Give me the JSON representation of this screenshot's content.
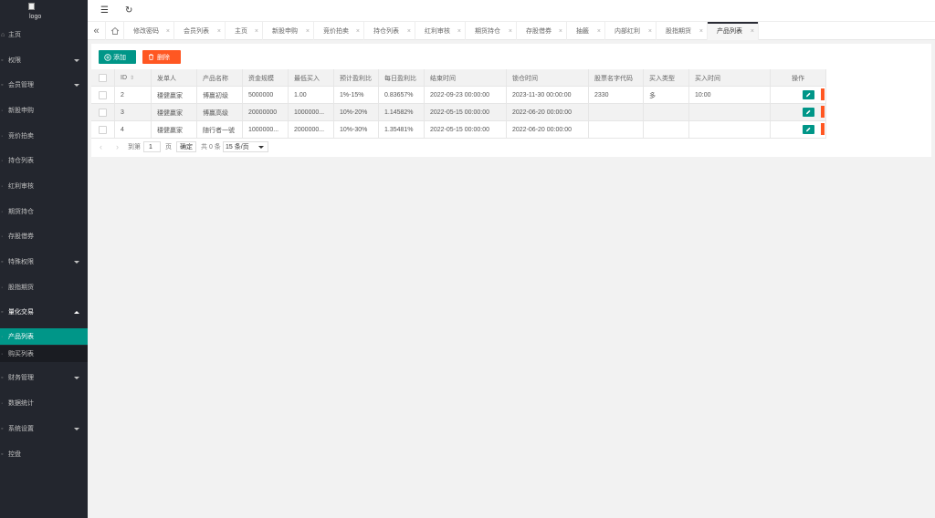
{
  "sidebar": {
    "logo_alt": "logo",
    "items": [
      {
        "label": "主页",
        "icon": "home-icon"
      },
      {
        "label": "权限",
        "icon": "lock-icon",
        "expandable": true
      },
      {
        "label": "会员管理",
        "icon": "user-icon",
        "expandable": true
      },
      {
        "label": "新股申购",
        "icon": "list-icon"
      },
      {
        "label": "竞价拍卖",
        "icon": "list-icon"
      },
      {
        "label": "持仓列表",
        "icon": "list-icon"
      },
      {
        "label": "红利审核",
        "icon": "list-icon"
      },
      {
        "label": "期货持仓",
        "icon": "list-icon"
      },
      {
        "label": "存股借券",
        "icon": "list-icon"
      },
      {
        "label": "特殊权限",
        "icon": "gear-icon",
        "expandable": true
      },
      {
        "label": "股指期货",
        "icon": "list-icon"
      },
      {
        "label": "量化交易",
        "icon": "gear-icon",
        "expandable": true,
        "open": true
      },
      {
        "label": "财务管理",
        "icon": "money-icon",
        "expandable": true
      },
      {
        "label": "数据统计",
        "icon": "chart-icon"
      },
      {
        "label": "系统设置",
        "icon": "gear-icon",
        "expandable": true
      },
      {
        "label": "控盘",
        "icon": "gear-icon"
      }
    ],
    "subitems": [
      {
        "label": "产品列表",
        "active": true
      },
      {
        "label": "购买列表",
        "active": false
      }
    ]
  },
  "header": {
    "menu_icon": "☰",
    "refresh_icon": "↻"
  },
  "tabs": {
    "left_nav": "«",
    "items": [
      {
        "label": "修改密码"
      },
      {
        "label": "会员列表"
      },
      {
        "label": "主页"
      },
      {
        "label": "新股申购"
      },
      {
        "label": "竞价拍卖"
      },
      {
        "label": "持仓列表"
      },
      {
        "label": "红利审核"
      },
      {
        "label": "期货持仓"
      },
      {
        "label": "存股借券"
      },
      {
        "label": "抽籤"
      },
      {
        "label": "内部红利"
      },
      {
        "label": "股指期货"
      },
      {
        "label": "产品列表",
        "active": true
      }
    ],
    "close_glyph": "×"
  },
  "toolbar": {
    "add_label": "添加",
    "delete_label": "删除"
  },
  "table": {
    "columns": [
      "ID",
      "发单人",
      "产品名称",
      "资金规模",
      "最低买入",
      "预计盈利比",
      "每日盈利比",
      "结束时间",
      "锁仓时间",
      "股票名字代码",
      "买入类型",
      "买入时间",
      "操作"
    ],
    "rows": [
      [
        "2",
        "穩健贏家",
        "博赢初级",
        "5000000",
        "1.00",
        "1%-15%",
        "0.83657%",
        "2022-09-23 00:00:00",
        "2023-11-30 00:00:00",
        "2330",
        "多",
        "10:00"
      ],
      [
        "3",
        "穩健贏家",
        "博赢高级",
        "20000000",
        "1000000...",
        "10%-20%",
        "1.14582%",
        "2022-05-15 00:00:00",
        "2022-06-20 00:00:00",
        "",
        "",
        ""
      ],
      [
        "4",
        "穩健贏家",
        "随行者一號",
        "1000000...",
        "2000000...",
        "10%-30%",
        "1.35481%",
        "2022-05-15 00:00:00",
        "2022-06-20 00:00:00",
        "",
        "",
        ""
      ]
    ]
  },
  "pager": {
    "prev": "‹",
    "next": "›",
    "goto_label": "到第",
    "page_value": "1",
    "page_suffix": "页",
    "confirm": "确定",
    "total": "共 0 条",
    "per_page": "15 条/页"
  },
  "colors": {
    "sidebar_bg": "#23262e",
    "accent": "#009688",
    "danger": "#ff5722"
  }
}
